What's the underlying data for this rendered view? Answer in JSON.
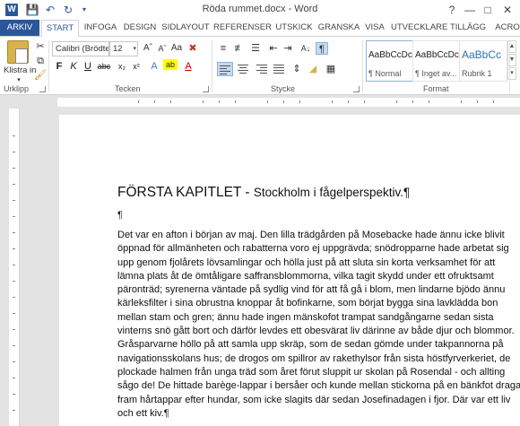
{
  "window": {
    "title": "Röda rummet.docx - Word",
    "logo": "W",
    "quick_access": [
      "save-icon",
      "undo-icon",
      "redo-icon"
    ],
    "controls": [
      "?",
      "—",
      "□",
      "✕"
    ]
  },
  "tabs": [
    "ARKIV",
    "START",
    "INFOGA",
    "DESIGN",
    "SIDLAYOUT",
    "REFERENSER",
    "UTSKICK",
    "GRANSKA",
    "VISA",
    "UTVECKLARE",
    "TILLÄGG",
    "ACRO"
  ],
  "active_tab": "START",
  "ribbon": {
    "clipboard": {
      "paste_label": "Klistra in",
      "group_label": "Urklipp"
    },
    "font": {
      "font_name": "Calibri (Brödte",
      "font_size": "12",
      "group_label": "Tecken"
    },
    "paragraph": {
      "group_label": "Stycke"
    },
    "styles": {
      "group_label": "Format",
      "items": [
        {
          "preview": "AaBbCcDc",
          "name": "¶ Normal"
        },
        {
          "preview": "AaBbCcDc",
          "name": "¶ Inget av..."
        },
        {
          "preview": "AaBbCc",
          "name": "Rubrik 1"
        }
      ]
    }
  },
  "document": {
    "title_main": "FÖRSTA KAPITLET",
    "title_sep": " - ",
    "title_sub": "Stockholm i fågelperspektiv.¶",
    "empty_para": "¶",
    "lines": [
      "Det var en afton i början av maj. Den lilla trädgården på Mosebacke hade ännu icke blivit",
      "öppnad för allmänheten och rabatterna voro ej uppgrävda; snödropparne hade arbetat sig",
      "upp genom fjolårets lövsamlingar och hölla just på att sluta sin korta verksamhet för att",
      "lämna plats åt de ömtåligare saffransblommorna, vilka tagit skydd under ett ofruktsamt",
      "päronträd; syrenerna väntade på sydlig vind för att få gå i blom, men lindarne bjödo ännu",
      "kärleksfilter i sina obrustna knoppar åt bofinkarne, som börjat bygga sina lavklädda bon",
      "mellan stam och gren; ännu hade ingen mänskofot trampat sandgångarne sedan sista",
      "vinterns snö gått bort och därför levdes ett obesvärat liv därinne av både djur och blommor.",
      "Gråsparvarne höllo på att samla upp skräp, som de sedan gömde under takpannorna på",
      "navigationsskolans hus; de drogos om spillror av rakethylsor från sista höstfyrverkeriet, de",
      "plockade halmen från unga träd som året förut sluppit ur skolan på Rosendal - och allting",
      "sågo de! De hittade barège-lappar i bersåer och kunde mellan stickorna på en bänkfot draga",
      "fram hårtappar efter hundar, som icke slagits där sedan Josefinadagen i fjor. Där var ett liv",
      "och ett kiv.¶"
    ]
  }
}
